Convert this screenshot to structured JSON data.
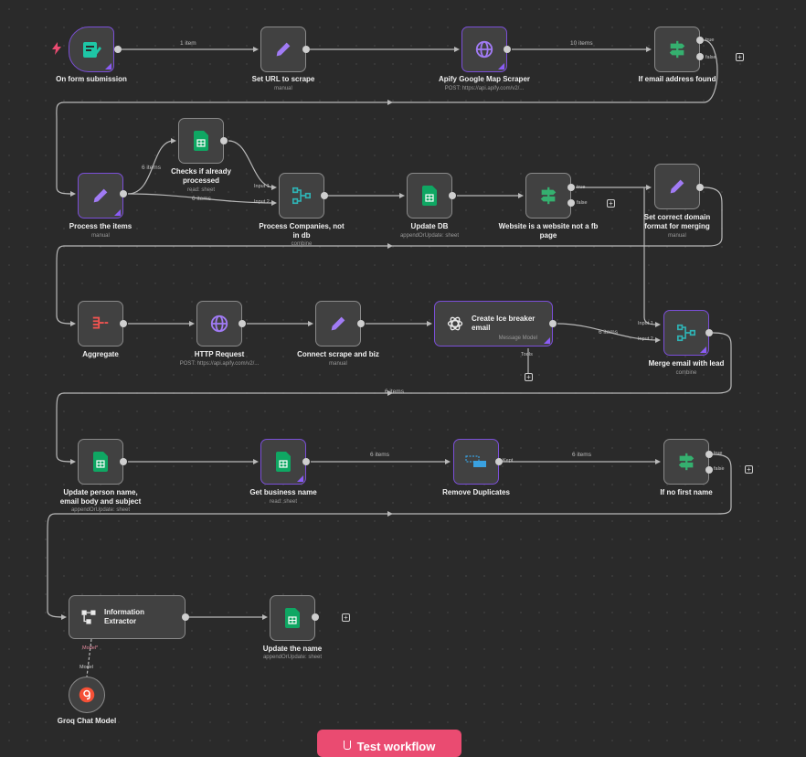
{
  "workflow": {
    "nodes": {
      "form": {
        "title": "On form submission"
      },
      "set_url": {
        "title": "Set URL to scrape",
        "subtitle": "manual"
      },
      "apify": {
        "title": "Apify Google Map Scraper",
        "subtitle": "POST: https://api.apify.com/v2/..."
      },
      "if_email": {
        "title": "If email address found"
      },
      "process_items": {
        "title": "Process the items",
        "subtitle": "manual"
      },
      "checks": {
        "title": "Checks if already processed",
        "subtitle": "read: sheet"
      },
      "process_companies": {
        "title": "Process Companies, not in db",
        "subtitle": "combine"
      },
      "update_db": {
        "title": "Update DB",
        "subtitle": "appendOrUpdate: sheet"
      },
      "website_check": {
        "title": "Website is a website not a fb page"
      },
      "set_domain": {
        "title": "Set correct domain format for merging",
        "subtitle": "manual"
      },
      "aggregate": {
        "title": "Aggregate"
      },
      "http_request": {
        "title": "HTTP Request",
        "subtitle": "POST: https://api.apify.com/v2/..."
      },
      "connect_scrape": {
        "title": "Connect scrape and biz",
        "subtitle": "manual"
      },
      "ice_breaker": {
        "title": "Create Ice breaker email",
        "subtitle": "Message Model"
      },
      "merge_email": {
        "title": "Merge email with lead",
        "subtitle": "combine"
      },
      "update_person": {
        "title": "Update person name, email body and subject",
        "subtitle": "appendOrUpdate: sheet"
      },
      "get_business": {
        "title": "Get business name",
        "subtitle": "read: sheet"
      },
      "remove_dup": {
        "title": "Remove Duplicates"
      },
      "if_no_first": {
        "title": "If no first name"
      },
      "info_extractor": {
        "title": "Information Extractor"
      },
      "update_name": {
        "title": "Update the name",
        "subtitle": "appendOrUpdate: sheet"
      },
      "groq": {
        "title": "Groq Chat Model"
      }
    },
    "edge_labels": {
      "one_item": "1 item",
      "ten_items": "10 items",
      "six_items_a": "6 items",
      "six_items_b": "6 items",
      "six_items_c": "6 items",
      "six_items_d": "6 items",
      "six_items_e": "6 items",
      "six_items_f": "6 items"
    },
    "port_labels": {
      "true": "true",
      "false": "false",
      "input1": "Input 1",
      "input2": "Input 2",
      "tools": "Tools",
      "keep": "Kept",
      "model_req": "Model*",
      "model": "Model"
    },
    "plus": "+"
  },
  "toolbar": {
    "test_button": "Test workflow"
  },
  "colors": {
    "accent": "#ea4b71",
    "selected": "#8b5cf6",
    "sheets": "#0fa763",
    "switch": "#35b06f",
    "edit": "#a17bf5",
    "globe": "#a17bf5",
    "merge": "#2fb3b5",
    "aggregate": "#ef5350"
  }
}
